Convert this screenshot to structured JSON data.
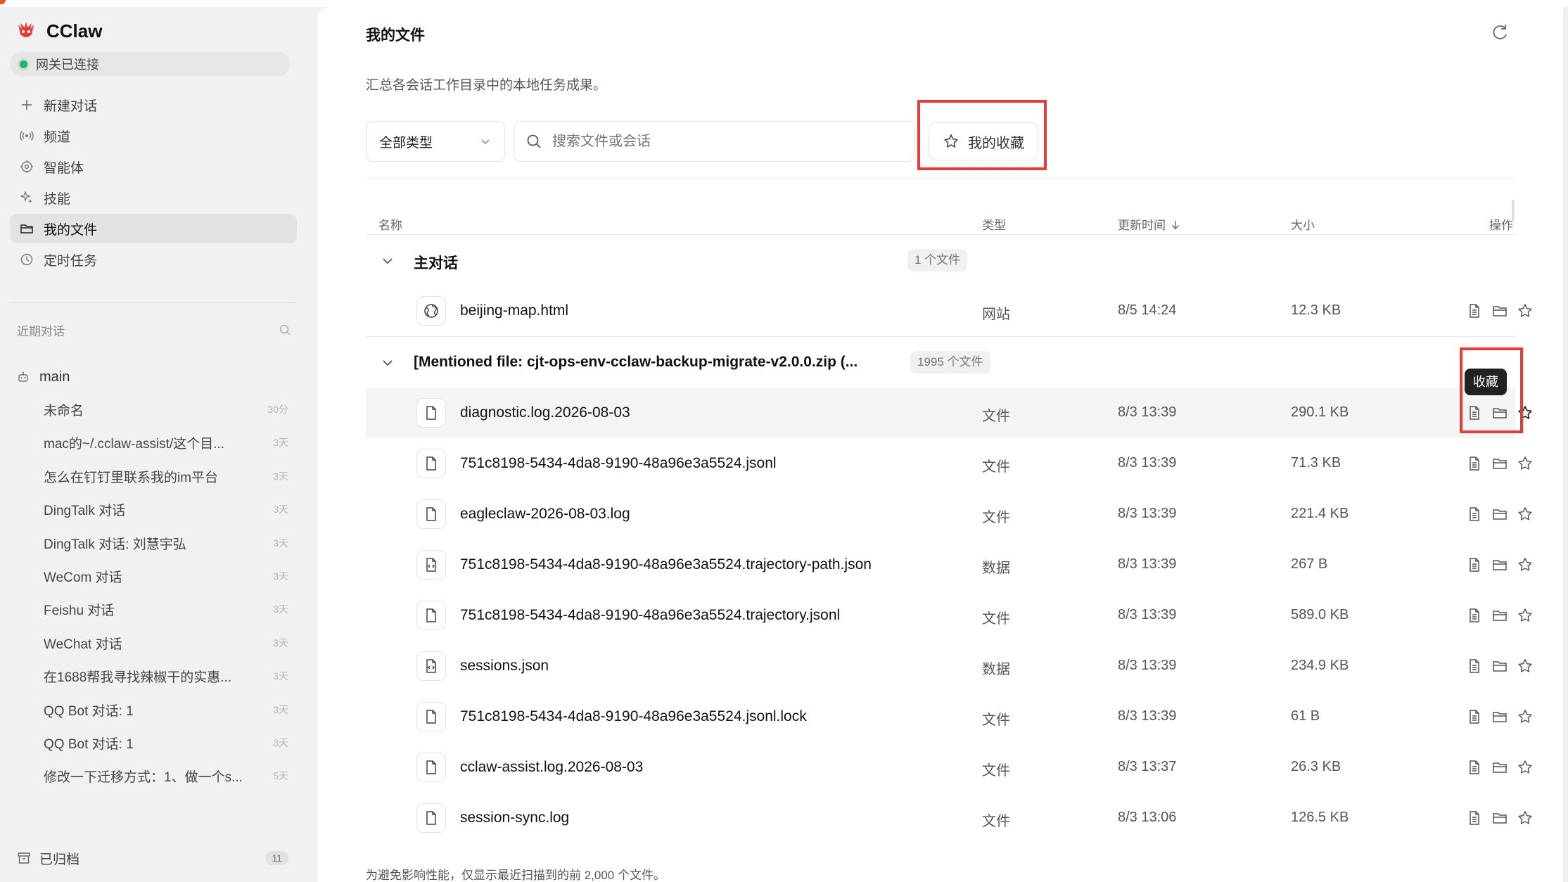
{
  "app": {
    "name": "CClaw",
    "status": "网关已连接"
  },
  "nav": {
    "new_chat": "新建对话",
    "items": [
      {
        "id": "channels",
        "label": "频道",
        "icon": "broadcast-icon"
      },
      {
        "id": "agents",
        "label": "智能体",
        "icon": "agent-icon"
      },
      {
        "id": "skills",
        "label": "技能",
        "icon": "sparkle-icon"
      },
      {
        "id": "files",
        "label": "我的文件",
        "icon": "folder-icon",
        "active": true
      },
      {
        "id": "tasks",
        "label": "定时任务",
        "icon": "clock-icon"
      }
    ]
  },
  "recent": {
    "title": "近期对话",
    "group": "main",
    "conversations": [
      {
        "title": "未命名",
        "ago": "30分"
      },
      {
        "title": "mac的~/.cclaw-assist/这个目...",
        "ago": "3天"
      },
      {
        "title": "怎么在钉钉里联系我的im平台",
        "ago": "3天"
      },
      {
        "title": "DingTalk 对话",
        "ago": "3天"
      },
      {
        "title": "DingTalk 对话: 刘慧宇弘",
        "ago": "3天"
      },
      {
        "title": "WeCom 对话",
        "ago": "3天"
      },
      {
        "title": "Feishu 对话",
        "ago": "3天"
      },
      {
        "title": "WeChat 对话",
        "ago": "3天"
      },
      {
        "title": "在1688帮我寻找辣椒干的实惠...",
        "ago": "3天"
      },
      {
        "title": "QQ Bot 对话: 1",
        "ago": "3天"
      },
      {
        "title": "QQ Bot 对话: 1",
        "ago": "3天"
      },
      {
        "title": "修改一下迁移方式：1、做一个s...",
        "ago": "5天"
      }
    ],
    "archived_label": "已归档",
    "archived_count": "11"
  },
  "page": {
    "title": "我的文件",
    "subtitle": "汇总各会话工作目录中的本地任务成果。",
    "type_filter": "全部类型",
    "search_placeholder": "搜索文件或会话",
    "favorites_label": "我的收藏",
    "tooltip": "收藏",
    "footnote": "为避免影响性能，仅显示最近扫描到的前 2,000 个文件。"
  },
  "table": {
    "columns": {
      "name": "名称",
      "type": "类型",
      "updated": "更新时间",
      "size": "大小",
      "actions": "操作"
    },
    "groups": [
      {
        "name": "主对话",
        "count": "1 个文件",
        "files": [
          {
            "name": "beijing-map.html",
            "type": "网站",
            "time": "8/5 14:24",
            "size": "12.3 KB",
            "icon": "globe-icon"
          }
        ]
      },
      {
        "name": "[Mentioned file: cjt-ops-env-cclaw-backup-migrate-v2.0.0.zip (...",
        "count": "1995 个文件",
        "files": [
          {
            "name": "diagnostic.log.2026-08-03",
            "type": "文件",
            "time": "8/3 13:39",
            "size": "290.1 KB",
            "icon": "file-icon"
          },
          {
            "name": "751c8198-5434-4da8-9190-48a96e3a5524.jsonl",
            "type": "文件",
            "time": "8/3 13:39",
            "size": "71.3 KB",
            "icon": "file-icon"
          },
          {
            "name": "eagleclaw-2026-08-03.log",
            "type": "文件",
            "time": "8/3 13:39",
            "size": "221.4 KB",
            "icon": "file-icon"
          },
          {
            "name": "751c8198-5434-4da8-9190-48a96e3a5524.trajectory-path.json",
            "type": "数据",
            "time": "8/3 13:39",
            "size": "267 B",
            "icon": "data-file-icon"
          },
          {
            "name": "751c8198-5434-4da8-9190-48a96e3a5524.trajectory.jsonl",
            "type": "文件",
            "time": "8/3 13:39",
            "size": "589.0 KB",
            "icon": "file-icon"
          },
          {
            "name": "sessions.json",
            "type": "数据",
            "time": "8/3 13:39",
            "size": "234.9 KB",
            "icon": "data-file-icon"
          },
          {
            "name": "751c8198-5434-4da8-9190-48a96e3a5524.jsonl.lock",
            "type": "文件",
            "time": "8/3 13:39",
            "size": "61 B",
            "icon": "file-icon"
          },
          {
            "name": "cclaw-assist.log.2026-08-03",
            "type": "文件",
            "time": "8/3 13:37",
            "size": "26.3 KB",
            "icon": "file-icon"
          },
          {
            "name": "session-sync.log",
            "type": "文件",
            "time": "8/3 13:06",
            "size": "126.5 KB",
            "icon": "file-icon"
          }
        ]
      }
    ]
  },
  "colors": {
    "accent_green": "#22b56a",
    "highlight_red": "#e23c3c",
    "sidebar_bg": "#f1f1f1",
    "main_bg": "#ffffff"
  }
}
